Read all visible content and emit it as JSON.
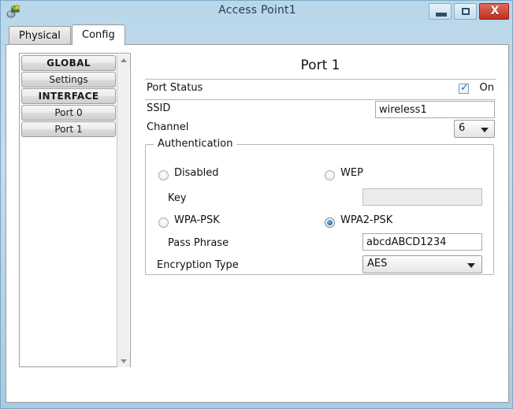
{
  "window": {
    "title": "Access Point1",
    "icon": "access-point-icon",
    "buttons": {
      "minimize": "minimize-button",
      "maximize": "maximize-button",
      "close_label": "X"
    }
  },
  "tabs": [
    {
      "label": "Physical",
      "active": false
    },
    {
      "label": "Config",
      "active": true
    }
  ],
  "sidebar": {
    "items": [
      {
        "label": "GLOBAL",
        "type": "header"
      },
      {
        "label": "Settings",
        "type": "item"
      },
      {
        "label": "INTERFACE",
        "type": "header"
      },
      {
        "label": "Port 0",
        "type": "item"
      },
      {
        "label": "Port 1",
        "type": "item"
      }
    ],
    "scrollbar": {
      "up_arrow": "scroll-up-arrow",
      "down_arrow": "scroll-down-arrow"
    }
  },
  "form": {
    "title": "Port 1",
    "port_status": {
      "label": "Port Status",
      "checked": true,
      "state_label": "On"
    },
    "ssid": {
      "label": "SSID",
      "value": "wireless1",
      "placeholder": ""
    },
    "channel": {
      "label": "Channel",
      "value": "6"
    },
    "authentication": {
      "legend": "Authentication",
      "options": [
        {
          "label": "Disabled",
          "selected": false
        },
        {
          "label": "WEP",
          "selected": false
        },
        {
          "label": "WPA-PSK",
          "selected": false
        },
        {
          "label": "WPA2-PSK",
          "selected": true
        }
      ],
      "key": {
        "label": "Key",
        "value": "",
        "disabled": true
      },
      "pass_phrase": {
        "label": "Pass Phrase",
        "value": "abcdABCD1234"
      },
      "encryption_type": {
        "label": "Encryption Type",
        "value": "AES"
      }
    }
  },
  "colors": {
    "titlebar_start": "#b9d7ea",
    "titlebar_end": "#a8cbe2",
    "close_button": "#bc2f20",
    "accent_blue": "#1f72b5",
    "panel_bg": "#ffffff"
  }
}
